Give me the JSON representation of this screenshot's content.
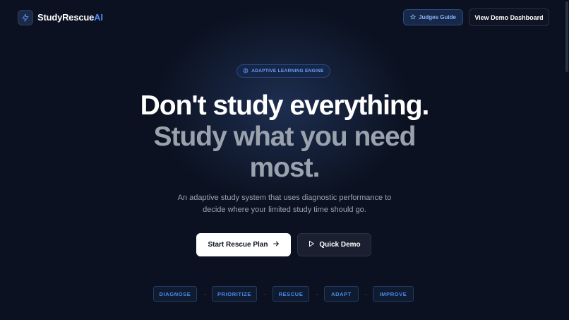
{
  "header": {
    "logo_primary": "StudyRescue",
    "logo_accent": "AI",
    "guide_label": "Judges Guide",
    "dashboard_label": "View Demo Dashboard"
  },
  "hero": {
    "badge": "ADAPTIVE LEARNING ENGINE",
    "headline_1": "Don't study everything.",
    "headline_2": "Study what you need",
    "headline_3": "most.",
    "subtitle_1": "An adaptive study system that uses diagnostic performance to",
    "subtitle_2": "decide where your limited study time should go."
  },
  "cta": {
    "start_label": "Start Rescue Plan",
    "quick_label": "Quick Demo"
  },
  "steps": [
    {
      "label": "DIAGNOSE"
    },
    {
      "label": "PRIORITIZE"
    },
    {
      "label": "RESCUE"
    },
    {
      "label": "ADAPT"
    },
    {
      "label": "IMPROVE"
    }
  ],
  "colors": {
    "background": "#0b1120",
    "accent": "#4f8cf0",
    "headline_muted": "#9aa2ad"
  },
  "icons": {
    "logo": "lightning-bolt-icon",
    "guide": "star-icon",
    "badge": "brain-icon",
    "start": "arrow-right-icon",
    "quick": "play-icon",
    "step_separator": "chevron-right-icon"
  }
}
